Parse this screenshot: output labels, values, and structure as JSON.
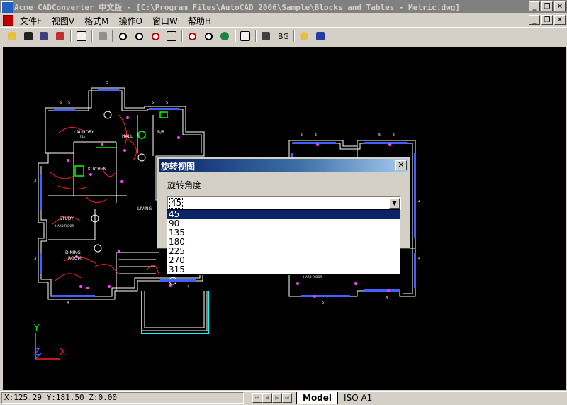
{
  "window": {
    "title": "Acme CADConverter 中文版 - [C:\\Program Files\\AutoCAD 2006\\Sample\\Blocks and Tables - Metric.dwg]",
    "minimize": "_",
    "restore": "❐",
    "close": "✕"
  },
  "menu": {
    "items": [
      "文件F",
      "视图V",
      "格式M",
      "操作O",
      "窗口W",
      "帮助H"
    ]
  },
  "toolbar": {
    "bg_label": "BG"
  },
  "drawing": {
    "labels": {
      "laundry": "LAUNDRY",
      "hall": "HALL",
      "br": "B/R",
      "kitchen": "KITCHEN",
      "study": "STUDY",
      "living": "LIVING",
      "dining": "DINING",
      "room": "ROOM",
      "hard_floor": "HARD FLOOR",
      "tile": "TILE"
    },
    "axis_y": "Y",
    "axis_z": "Z",
    "axis_x": "X",
    "colors": {
      "walls": "#ffffff",
      "blue": "#4060ff",
      "red": "#ff2020",
      "magenta": "#ff40ff",
      "green": "#00ff00",
      "cyan": "#00ffff"
    }
  },
  "dialog": {
    "title": "旋转视图",
    "close": "✕",
    "label": "旋转角度",
    "value": "45",
    "options": [
      "45",
      "90",
      "135",
      "180",
      "225",
      "270",
      "315"
    ],
    "selected_index": 0
  },
  "status": {
    "coords": "X:125.29 Y:181.50 Z:0.00",
    "tabs": [
      "Model",
      "ISO A1"
    ],
    "active_tab": 0
  }
}
